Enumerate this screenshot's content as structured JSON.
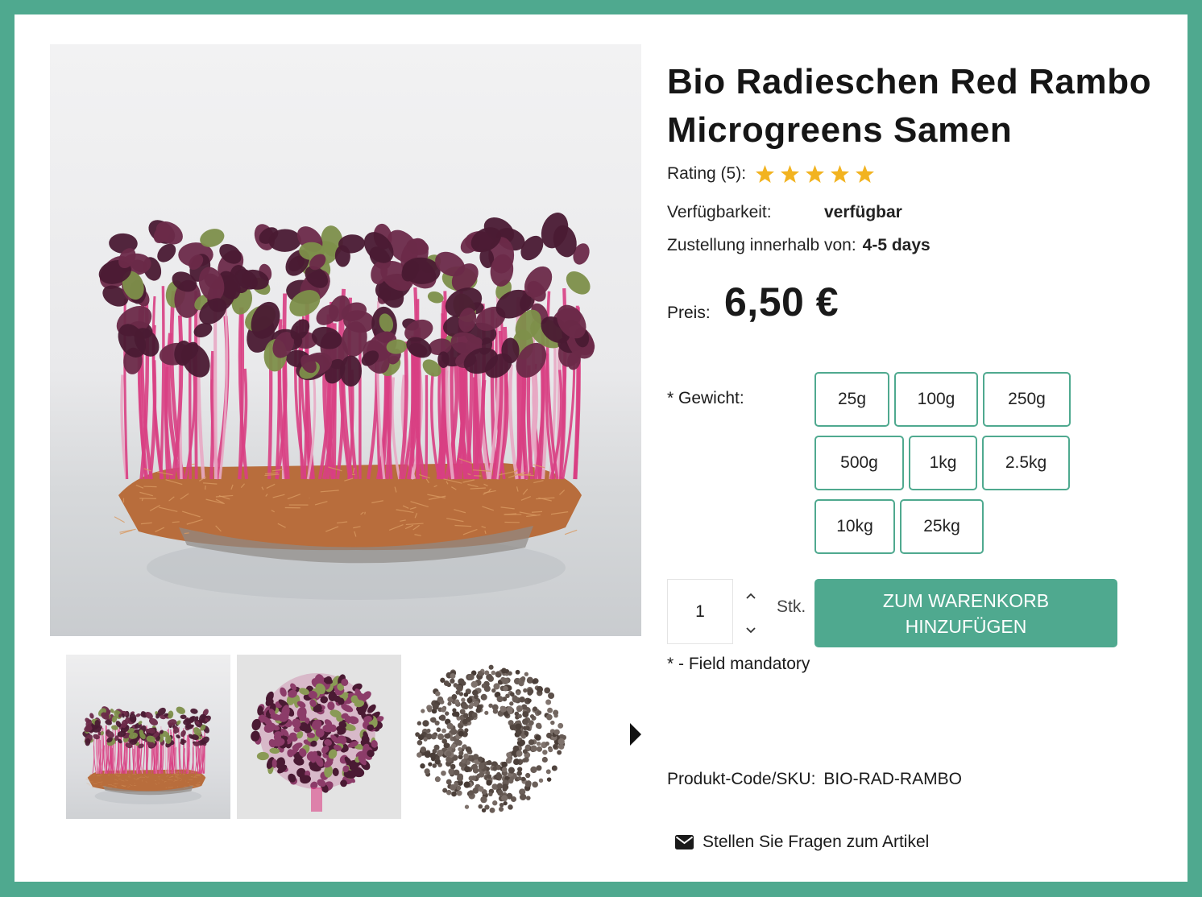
{
  "product": {
    "title": "Bio Radieschen Red Rambo Microgreens Samen",
    "rating_label": "Rating (5):",
    "rating_value": 5,
    "availability_label": "Verfügbarkeit:",
    "availability_value": "verfügbar",
    "delivery_label": "Zustellung innerhalb von:",
    "delivery_value": "4-5 days",
    "price_label": "Preis:",
    "price_value": "6,50 €",
    "weight_label": "* Gewicht:",
    "weight_options": [
      "25g",
      "100g",
      "250g",
      "500g",
      "1kg",
      "2.5kg",
      "10kg",
      "25kg"
    ],
    "quantity_value": "1",
    "quantity_unit": "Stk.",
    "add_to_cart_label": "ZUM WARENKORB HINZUFÜGEN",
    "mandatory_note": "* - Field mandatory",
    "sku_label": "Produkt-Code/SKU:",
    "sku_value": "BIO-RAD-RAMBO",
    "ask_question_label": "Stellen Sie Fragen zum Artikel"
  },
  "gallery": {
    "thumbnails": [
      "microgreens-side-photo",
      "microgreens-top-photo",
      "seeds-photo"
    ],
    "next_icon": "caret-right-icon"
  },
  "colors": {
    "accent": "#4fa98f",
    "star": "#f2b320",
    "stem": "#d83f83",
    "leaf": "#4a1a33",
    "mat": "#b86d3c"
  }
}
